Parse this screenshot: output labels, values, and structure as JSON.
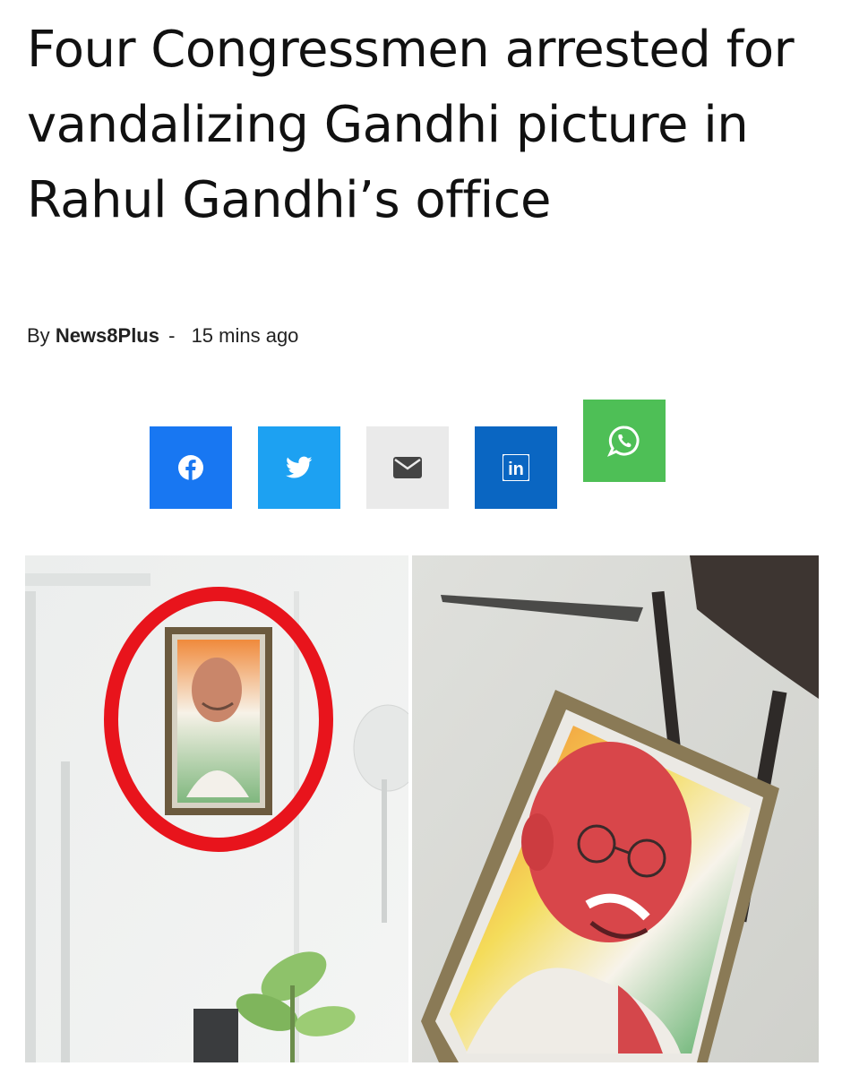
{
  "article": {
    "headline": "Four Congressmen arrested for vandalizing Gandhi picture in Rahul Gandhi’s office",
    "byline_prefix": "By",
    "author": "News8Plus",
    "byline_separator": "-",
    "time_ago": "15 mins ago"
  },
  "share_buttons": [
    {
      "icon": "facebook-icon",
      "color": "#1877f2"
    },
    {
      "icon": "twitter-icon",
      "color": "#1da1f2"
    },
    {
      "icon": "email-icon",
      "color": "#eaeaea"
    },
    {
      "icon": "linkedin-icon",
      "color": "#0a66c2",
      "glyph": "in"
    },
    {
      "icon": "whatsapp-icon",
      "color": "#4ebf56"
    }
  ],
  "colors": {
    "highlight_circle": "#e8141c",
    "text": "#111111"
  }
}
